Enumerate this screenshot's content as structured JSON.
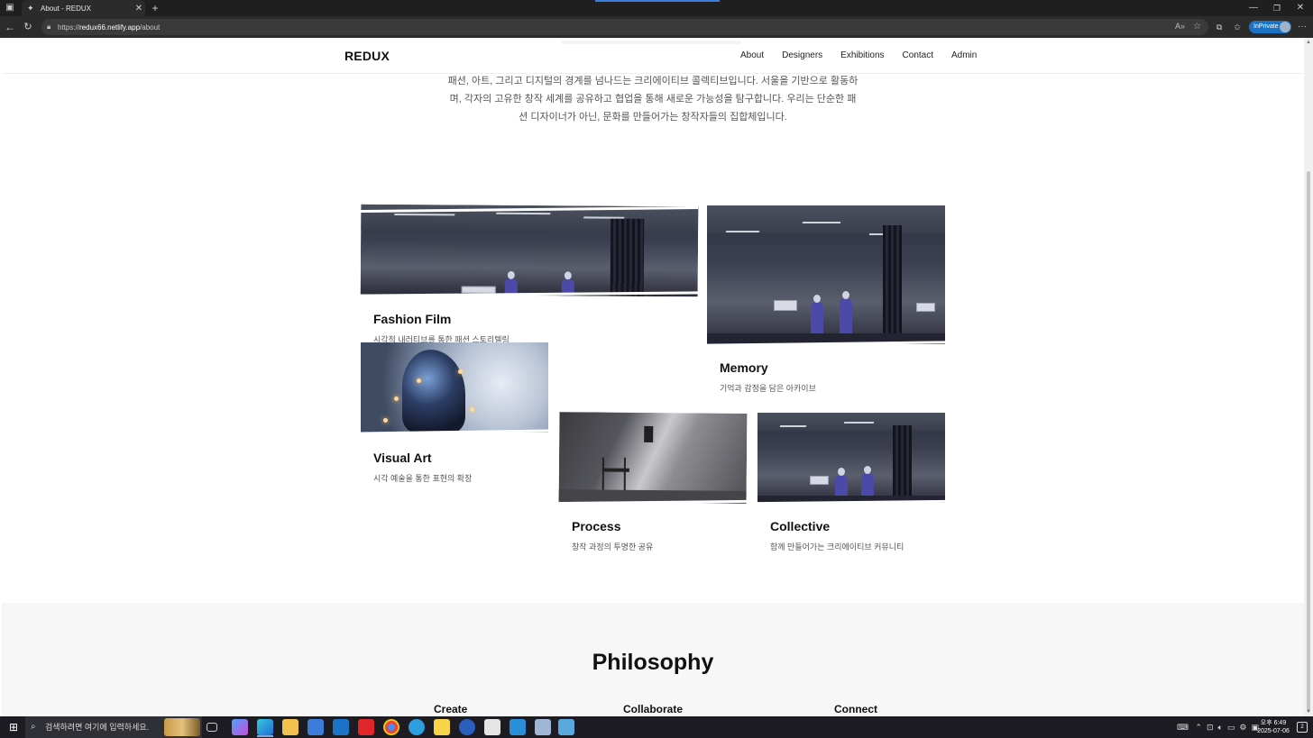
{
  "browser": {
    "tab_title": "About - REDUX",
    "tab_close": "✕",
    "new_tab": "+",
    "url_prefix": "https://",
    "url_host": "redux66.netlify.app",
    "url_path": "/about",
    "inprivate_label": "InPrivate"
  },
  "nav": {
    "brand": "REDUX",
    "links": [
      "About",
      "Designers",
      "Exhibitions",
      "Contact",
      "Admin"
    ]
  },
  "intro": {
    "line1": "패션, 아트, 그리고 디지털의 경계를 넘나드는 크리에이티브 콜렉티브입니다. 서울을 기반으로 활동하",
    "line2": "며, 각자의 고유한 창작 세계를 공유하고 협업을 통해 새로운 가능성을 탐구합니다. 우리는 단순한 패",
    "line3": "션 디자이너가 아닌, 문화를 만들어가는 창작자들의 집합체입니다."
  },
  "cards": [
    {
      "title": "Fashion Film",
      "desc": "시각적 내러티브를 통한 패션 스토리텔링",
      "image": "gallery-mannequins"
    },
    {
      "title": "Memory",
      "desc": "기억과 감정을 담은 아카이브",
      "image": "gallery-mannequins"
    },
    {
      "title": "Visual Art",
      "desc": "시각 예술을 통한 표현의 확장",
      "image": "digital-art-figure"
    },
    {
      "title": "Process",
      "desc": "창작 과정의 투명한 공유",
      "image": "studio-chair"
    },
    {
      "title": "Collective",
      "desc": "함께 만들어가는 크리에이티브 커뮤니티",
      "image": "gallery-mannequins"
    }
  ],
  "philosophy": {
    "title": "Philosophy",
    "columns": [
      "Create",
      "Collaborate",
      "Connect"
    ]
  },
  "taskbar": {
    "search_placeholder": "검색하려면 여기에 입력하세요.",
    "time": "오후 6:49",
    "date": "2025-07-06",
    "notification_count": "2",
    "accent": "#7aa9e6"
  }
}
